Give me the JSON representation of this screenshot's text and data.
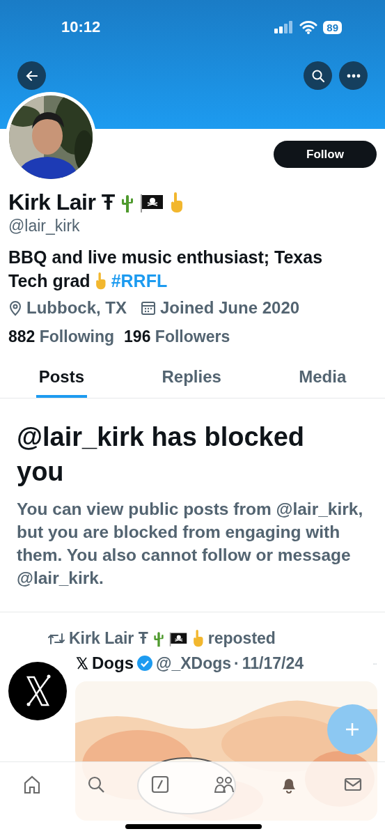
{
  "status_bar": {
    "time": "10:12",
    "battery": "89"
  },
  "profile": {
    "name": "Kirk Lair Ŧ",
    "handle": "@lair_kirk",
    "follow_button": "Follow",
    "bio_lines": [
      "BBQ and live music enthusiast; Texas",
      "Tech grad"
    ],
    "bio_link": "#RRFL",
    "location": "Lubbock, TX",
    "joined": "Joined June 2020",
    "stats": [
      {
        "count": "882",
        "label": "Following"
      },
      {
        "count": "196",
        "label": "Followers"
      }
    ]
  },
  "tabs": [
    {
      "label": "Posts",
      "selected": true
    },
    {
      "label": "Replies",
      "selected": false
    },
    {
      "label": "Media",
      "selected": false
    }
  ],
  "blocked_notice": {
    "title": "@lair_kirk has blocked you",
    "body": "You can view public posts from @lair_kirk, but you are blocked from engaging with them. You also cannot follow or message @lair_kirk."
  },
  "post": {
    "repost_name": "Kirk Lair Ŧ",
    "repost_label": "reposted",
    "author": "Dogs",
    "verified": true,
    "handle": "@_XDogs",
    "separator": "·",
    "date": "11/17/24"
  }
}
